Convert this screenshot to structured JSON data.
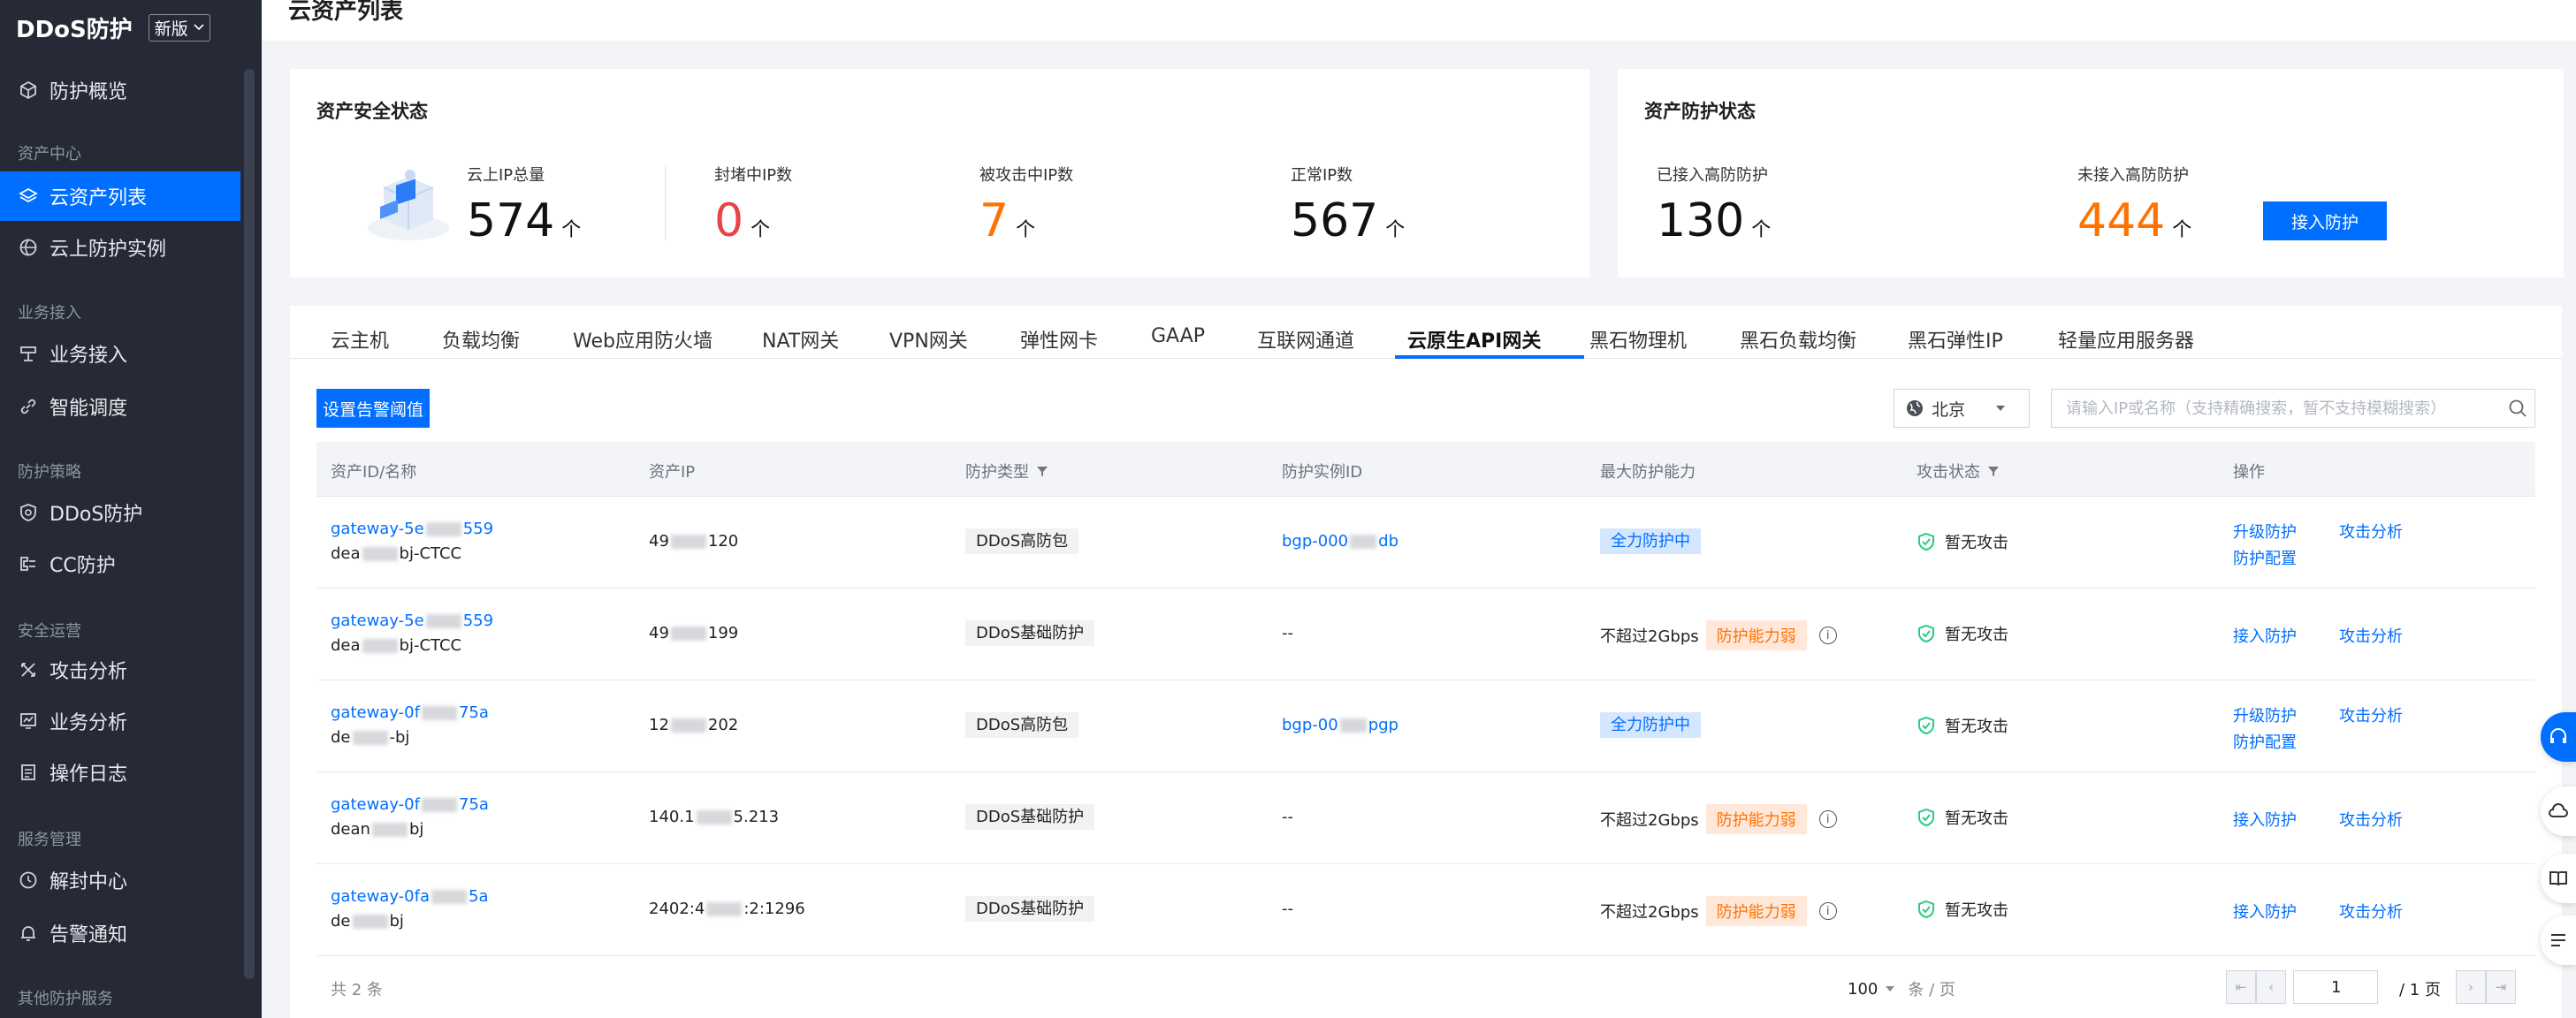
{
  "sidebar": {
    "title": "DDoS防护",
    "version": "新版",
    "items": [
      {
        "label": "防护概览",
        "icon": "cube-icon"
      },
      {
        "group": "资产中心"
      },
      {
        "label": "云资产列表",
        "icon": "layers-icon",
        "active": true
      },
      {
        "label": "云上防护实例",
        "icon": "globe-icon"
      },
      {
        "group": "业务接入"
      },
      {
        "label": "业务接入",
        "icon": "access-icon"
      },
      {
        "label": "智能调度",
        "icon": "link-icon"
      },
      {
        "group": "防护策略"
      },
      {
        "label": "DDoS防护",
        "icon": "shield-icon"
      },
      {
        "label": "CC防护",
        "icon": "cc-icon"
      },
      {
        "group": "安全运营"
      },
      {
        "label": "攻击分析",
        "icon": "attack-icon"
      },
      {
        "label": "业务分析",
        "icon": "chart-icon"
      },
      {
        "label": "操作日志",
        "icon": "log-icon"
      },
      {
        "group": "服务管理"
      },
      {
        "label": "解封中心",
        "icon": "unblock-icon"
      },
      {
        "label": "告警通知",
        "icon": "bell-icon"
      },
      {
        "group": "其他防护服务"
      }
    ]
  },
  "page": {
    "title": "云资产列表"
  },
  "security_status": {
    "title": "资产安全状态",
    "stats": [
      {
        "label": "云上IP总量",
        "value": "574",
        "unit": "个",
        "color": "#111111"
      },
      {
        "label": "封堵中IP数",
        "value": "0",
        "unit": "个",
        "color": "#e54545"
      },
      {
        "label": "被攻击中IP数",
        "value": "7",
        "unit": "个",
        "color": "#ff7200"
      },
      {
        "label": "正常IP数",
        "value": "567",
        "unit": "个",
        "color": "#111111"
      }
    ]
  },
  "protection_status": {
    "title": "资产防护状态",
    "stats": [
      {
        "label": "已接入高防防护",
        "value": "130",
        "unit": "个",
        "color": "#111111"
      },
      {
        "label": "未接入高防防护",
        "value": "444",
        "unit": "个",
        "color": "#ff7200"
      }
    ],
    "button": "接入防护"
  },
  "tabs": [
    "云主机",
    "负载均衡",
    "Web应用防火墙",
    "NAT网关",
    "VPN网关",
    "弹性网卡",
    "GAAP",
    "互联网通道",
    "云原生API网关",
    "黑石物理机",
    "黑石负载均衡",
    "黑石弹性IP",
    "轻量应用服务器"
  ],
  "active_tab": "云原生API网关",
  "toolbar": {
    "alert_button": "设置告警阈值",
    "region": "北京",
    "search_placeholder": "请输入IP或名称（支持精确搜索，暂不支持模糊搜索）"
  },
  "table": {
    "headers": [
      "资产ID/名称",
      "资产IP",
      "防护类型",
      "防护实例ID",
      "最大防护能力",
      "攻击状态",
      "操作"
    ],
    "rows": [
      {
        "id_a": "gateway-5e",
        "id_b": "559",
        "name_a": "dea",
        "name_b": "bj-CTCC",
        "ip_a": "49",
        "ip_b": "120",
        "type": "DDoS高防包",
        "inst_a": "bgp-000",
        "inst_b": "db",
        "capacity": "",
        "capacity_tag": "全力防护中",
        "capacity_tag_type": "blue",
        "status": "暂无攻击",
        "ops": [
          "升级防护",
          "攻击分析",
          "防护配置"
        ]
      },
      {
        "id_a": "gateway-5e",
        "id_b": "559",
        "name_a": "dea",
        "name_b": "bj-CTCC",
        "ip_a": "49",
        "ip_b": "199",
        "type": "DDoS基础防护",
        "inst_a": "--",
        "inst_b": "",
        "capacity": "不超过2Gbps",
        "capacity_tag": "防护能力弱",
        "capacity_tag_type": "orange",
        "status": "暂无攻击",
        "ops": [
          "接入防护",
          "攻击分析"
        ]
      },
      {
        "id_a": "gateway-0f",
        "id_b": "75a",
        "name_a": "de",
        "name_b": "-bj",
        "ip_a": "12",
        "ip_b": "202",
        "type": "DDoS高防包",
        "inst_a": "bgp-00",
        "inst_b": "pgp",
        "capacity": "",
        "capacity_tag": "全力防护中",
        "capacity_tag_type": "blue",
        "status": "暂无攻击",
        "ops": [
          "升级防护",
          "攻击分析",
          "防护配置"
        ]
      },
      {
        "id_a": "gateway-0f",
        "id_b": "75a",
        "name_a": "dean",
        "name_b": "bj",
        "ip_a": "140.1",
        "ip_b": "5.213",
        "type": "DDoS基础防护",
        "inst_a": "--",
        "inst_b": "",
        "capacity": "不超过2Gbps",
        "capacity_tag": "防护能力弱",
        "capacity_tag_type": "orange",
        "status": "暂无攻击",
        "ops": [
          "接入防护",
          "攻击分析"
        ]
      },
      {
        "id_a": "gateway-0fa",
        "id_b": "5a",
        "name_a": "de",
        "name_b": "bj",
        "ip_a": "2402:4",
        "ip_b": ":2:1296",
        "type": "DDoS基础防护",
        "inst_a": "--",
        "inst_b": "",
        "capacity": "不超过2Gbps",
        "capacity_tag": "防护能力弱",
        "capacity_tag_type": "orange",
        "status": "暂无攻击",
        "ops": [
          "接入防护",
          "攻击分析"
        ]
      }
    ]
  },
  "footer": {
    "total": "共 2 条",
    "page_size": "100",
    "page_size_unit": "条 / 页",
    "current_page": "1",
    "total_pages": "/ 1 页"
  },
  "colors": {
    "accent": "#006eff",
    "sidebar_bg": "#252a36",
    "success": "#29cc85",
    "warning": "#ff7200"
  }
}
